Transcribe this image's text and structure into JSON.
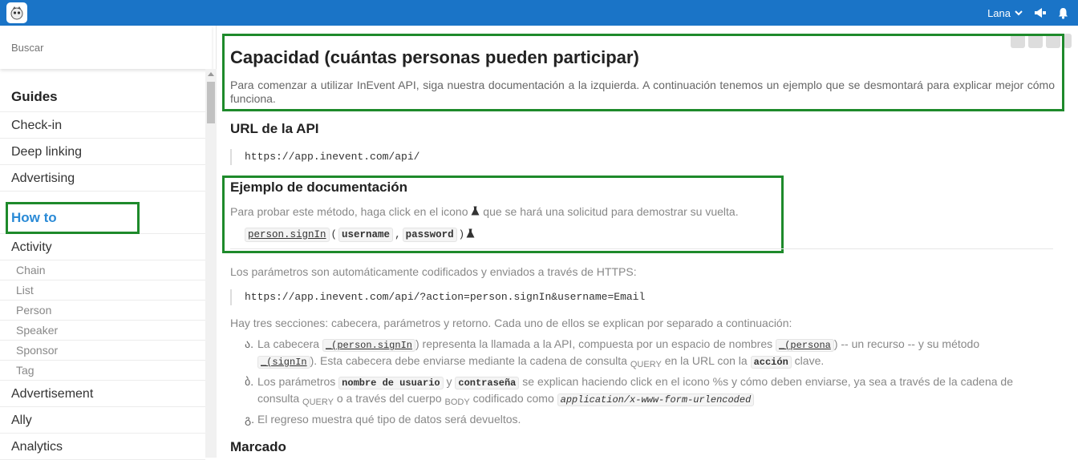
{
  "topbar": {
    "user_name": "Lana",
    "color": "#1a74c7"
  },
  "sidebar": {
    "search_placeholder": "Buscar",
    "guides_heading": "Guides",
    "guides": [
      "Check-in",
      "Deep linking",
      "Advertising"
    ],
    "howto_heading": "How to",
    "activity": "Activity",
    "activity_sub": [
      "Chain",
      "List",
      "Person",
      "Speaker",
      "Sponsor",
      "Tag"
    ],
    "more": [
      "Advertisement",
      "Ally",
      "Analytics"
    ]
  },
  "main": {
    "title": "Capacidad (cuántas personas pueden participar)",
    "intro": "Para comenzar a utilizar InEvent API, siga nuestra documentación a la izquierda. A continuación tenemos un ejemplo que se desmontará para explicar mejor cómo funciona.",
    "url_heading": "URL de la API",
    "api_url": "https://app.inevent.com/api/",
    "example_heading": "Ejemplo de documentación",
    "example_text_1": "Para probar este método, haga click en el icono",
    "example_text_2": "que se hará una solicitud para demostrar su vuelta.",
    "method_name": "person.signIn",
    "param_1": "username",
    "param_2": "password",
    "encoded_text": "Los parámetros son automáticamente codificados y enviados a través de HTTPS:",
    "full_url": "https://app.inevent.com/api/?action=person.signIn&username=Email",
    "sections_intro": "Hay tres secciones: cabecera, parámetros y retorno. Cada uno de ellos se explican por separado a continuación:",
    "sections": {
      "s1_marker": "ა.",
      "s1_a": "La cabecera",
      "s1_code1": "_(person.signIn",
      "s1_b": ") representa la llamada a la API, compuesta por un espacio de nombres",
      "s1_code2": "_(persona",
      "s1_c": ") -- un recurso -- y su método",
      "s1_code3": "_(signIn",
      "s1_d": "). Esta cabecera debe enviarse mediante la cadena de consulta",
      "s1_query": "QUERY",
      "s1_e": "en la URL con la",
      "s1_code4": "acción",
      "s1_f": "clave.",
      "s2_marker": "ბ.",
      "s2_a": "Los parámetros",
      "s2_code1": "nombre de usuario",
      "s2_b": "y",
      "s2_code2": "contraseña",
      "s2_c": "se explican haciendo click en el icono %s y cómo deben enviarse, ya sea a través de la cadena de consulta",
      "s2_query": "QUERY",
      "s2_d": "o a través del cuerpo",
      "s2_body": "BODY",
      "s2_e": "codificado como",
      "s2_code3": "application/x-www-form-urlencoded",
      "s3_marker": "გ.",
      "s3_text": "El regreso muestra qué tipo de datos será devueltos."
    },
    "marked_heading": "Marcado",
    "highlight_color": "#1e8a2b"
  }
}
